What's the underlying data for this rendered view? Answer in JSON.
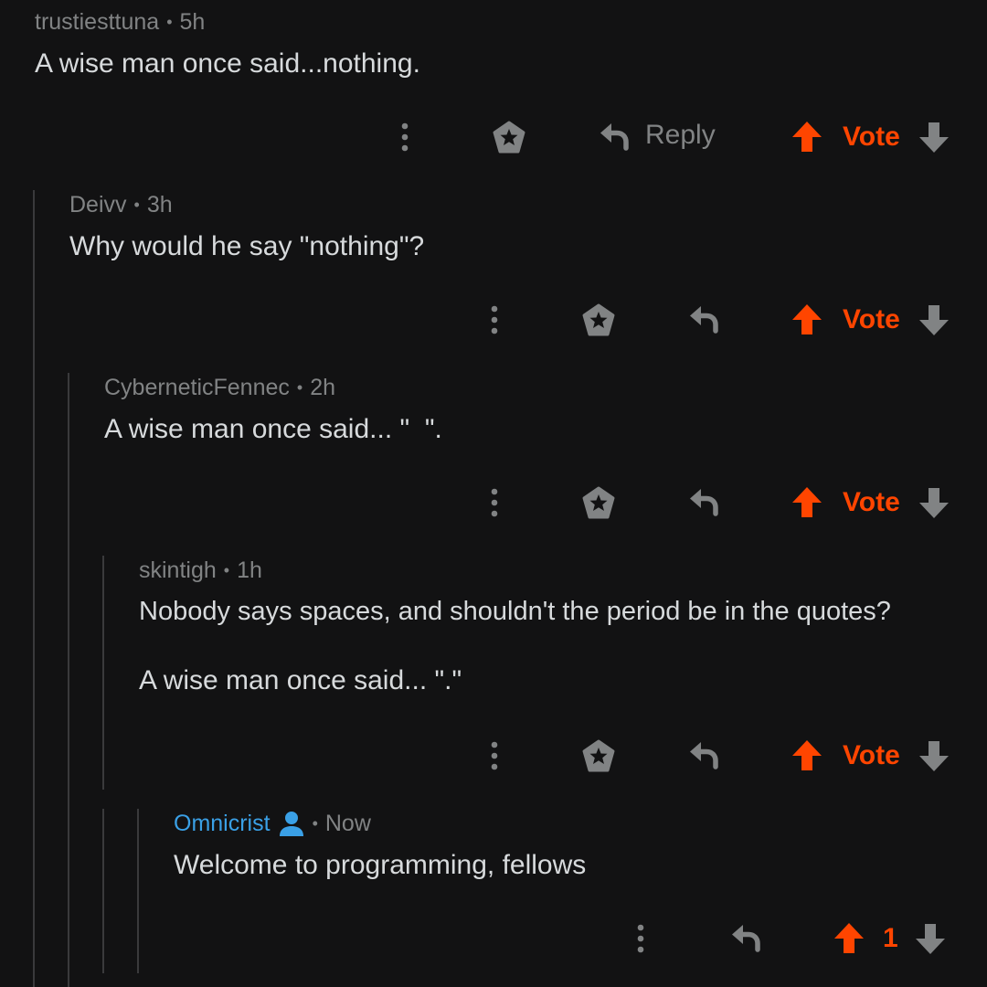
{
  "colors": {
    "background": "#121213",
    "text": "#d7dadc",
    "meta": "#818384",
    "upvote": "#ff4500",
    "op_author": "#3aa0e6",
    "thread_line": "#3a3a3c"
  },
  "comments": [
    {
      "author": "trustiesttuna",
      "separator": "•",
      "age": "5h",
      "body": [
        "A wise man once said...nothing."
      ],
      "actions": {
        "reply_label": "Reply",
        "vote_label": "Vote"
      }
    },
    {
      "author": "Deivv",
      "separator": "•",
      "age": "3h",
      "body": [
        "Why would he say \"nothing\"?"
      ],
      "actions": {
        "vote_label": "Vote"
      }
    },
    {
      "author": "CyberneticFennec",
      "separator": "•",
      "age": "2h",
      "body": [
        "A wise man once said... \"  \"."
      ],
      "actions": {
        "vote_label": "Vote"
      }
    },
    {
      "author": "skintigh",
      "separator": "•",
      "age": "1h",
      "body": [
        "Nobody says spaces, and shouldn't the period be in the quotes?",
        "A wise man once said... \".\""
      ],
      "actions": {
        "vote_label": "Vote"
      }
    },
    {
      "author": "Omnicrist",
      "author_icon": "user-icon",
      "separator": "•",
      "age": "Now",
      "body": [
        "Welcome to programming, fellows"
      ],
      "actions": {
        "score": "1"
      }
    }
  ],
  "icons": {
    "more": "more-vertical-icon",
    "award": "award-icon",
    "reply": "reply-arrow-icon",
    "upvote": "upvote-arrow-icon",
    "downvote": "downvote-arrow-icon"
  }
}
